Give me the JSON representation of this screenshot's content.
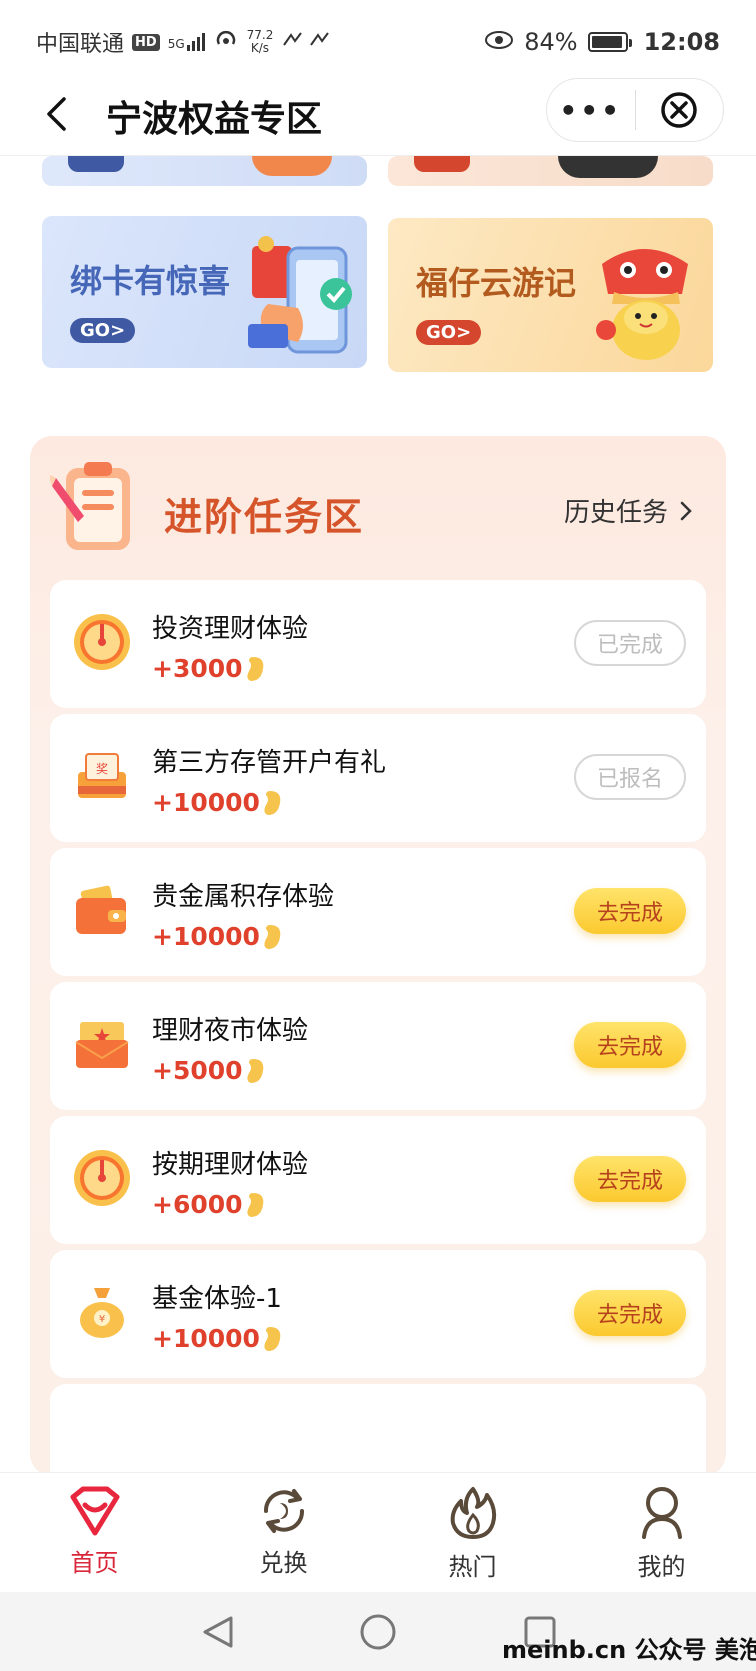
{
  "status_bar": {
    "carrier": "中国联通",
    "hd": "HD",
    "network": "5G",
    "speed_value": "77.2",
    "speed_unit": "K/s",
    "battery_percent": "84%",
    "time": "12:08"
  },
  "title_bar": {
    "title": "宁波权益专区",
    "more_label": "•••"
  },
  "banners": [
    {
      "title": "绑卡有惊喜",
      "go": "GO>"
    },
    {
      "title": "福仔云游记",
      "go": "GO>"
    }
  ],
  "task_section": {
    "title": "进阶任务区",
    "history_label": "历史任务",
    "tasks": [
      {
        "name": "投资理财体验",
        "reward": "+3000",
        "button": "已完成",
        "state": "done",
        "icon": "wheel-icon"
      },
      {
        "name": "第三方存管开户有礼",
        "reward": "+10000",
        "button": "已报名",
        "state": "done",
        "icon": "prize-box-icon"
      },
      {
        "name": "贵金属积存体验",
        "reward": "+10000",
        "button": "去完成",
        "state": "go",
        "icon": "wallet-icon"
      },
      {
        "name": "理财夜市体验",
        "reward": "+5000",
        "button": "去完成",
        "state": "go",
        "icon": "envelope-icon"
      },
      {
        "name": "按期理财体验",
        "reward": "+6000",
        "button": "去完成",
        "state": "go",
        "icon": "wheel-icon"
      },
      {
        "name": "基金体验-1",
        "reward": "+10000",
        "button": "去完成",
        "state": "go",
        "icon": "money-bag-icon"
      }
    ]
  },
  "bottom_nav": [
    {
      "label": "首页",
      "icon": "diamond-smile-icon",
      "active": true
    },
    {
      "label": "兑换",
      "icon": "exchange-icon",
      "active": false
    },
    {
      "label": "热门",
      "icon": "flame-icon",
      "active": false
    },
    {
      "label": "我的",
      "icon": "person-icon",
      "active": false
    }
  ],
  "watermark": "meinb.cn  公众号 美泡君",
  "colors": {
    "accent_red": "#e0412c",
    "active_nav": "#d9263a",
    "go_button": "#fbc92f",
    "section_bg": "#fdeee6"
  }
}
